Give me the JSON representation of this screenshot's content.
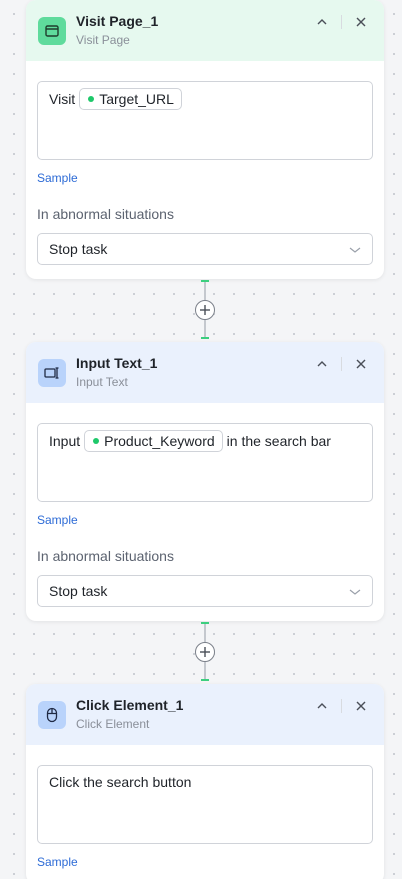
{
  "steps": [
    {
      "title": "Visit Page_1",
      "subtitle": "Visit Page",
      "icon": "browser-window-icon",
      "text_before": "Visit",
      "variable": "Target_URL",
      "text_after": "",
      "sample_label": "Sample",
      "abnormal_label": "In abnormal situations",
      "abnormal_value": "Stop task"
    },
    {
      "title": "Input Text_1",
      "subtitle": "Input Text",
      "icon": "keyboard-input-icon",
      "text_before": "Input",
      "variable": "Product_Keyword",
      "text_after": "in the search bar",
      "sample_label": "Sample",
      "abnormal_label": "In abnormal situations",
      "abnormal_value": "Stop task"
    },
    {
      "title": "Click Element_1",
      "subtitle": "Click Element",
      "icon": "mouse-icon",
      "text": "Click the search button",
      "sample_label": "Sample"
    }
  ],
  "colors": {
    "visit_header_bg": "#e6f9ef",
    "action_header_bg": "#eaf1fd",
    "variable_dot": "#1ec86a",
    "link": "#2d6bd6",
    "connector_accent": "#3ccf7f"
  }
}
